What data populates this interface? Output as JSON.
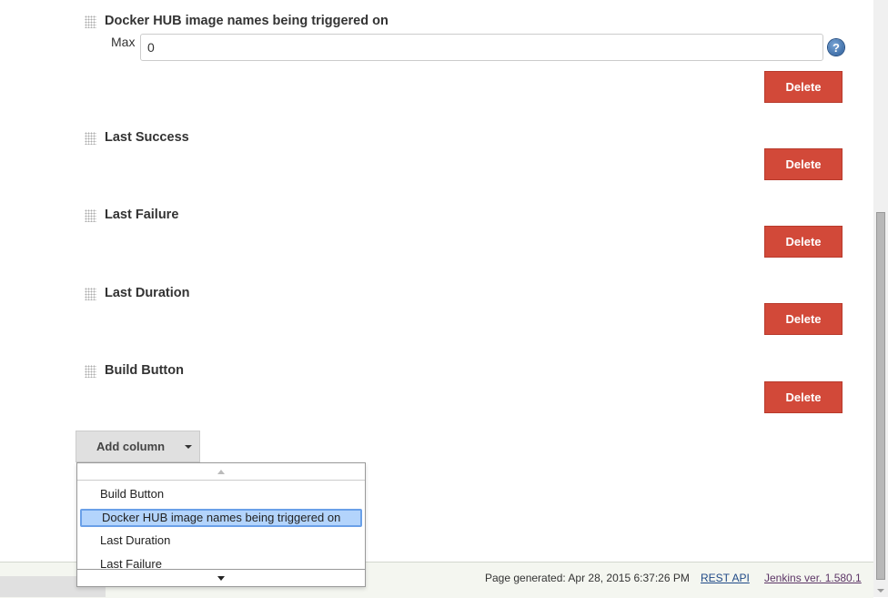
{
  "columns": [
    {
      "title": "Docker HUB image names being triggered on",
      "field_label": "Max",
      "field_value": "0",
      "delete_label": "Delete"
    },
    {
      "title": "Last Success",
      "delete_label": "Delete"
    },
    {
      "title": "Last Failure",
      "delete_label": "Delete"
    },
    {
      "title": "Last Duration",
      "delete_label": "Delete"
    },
    {
      "title": "Build Button",
      "delete_label": "Delete"
    }
  ],
  "help_icon": "?",
  "add_column": {
    "label": "Add column",
    "options": [
      "Build Button",
      "Docker HUB image names being triggered on",
      "Last Duration",
      "Last Failure"
    ],
    "selected": "Docker HUB image names being triggered on"
  },
  "footer": {
    "generated": "Page generated: Apr 28, 2015 6:37:26 PM",
    "rest_api": "REST API",
    "version": "Jenkins ver. 1.580.1"
  },
  "colors": {
    "delete": "#d24939",
    "selection": "#b3d4fc",
    "footer_bg": "#f4f6f0"
  }
}
